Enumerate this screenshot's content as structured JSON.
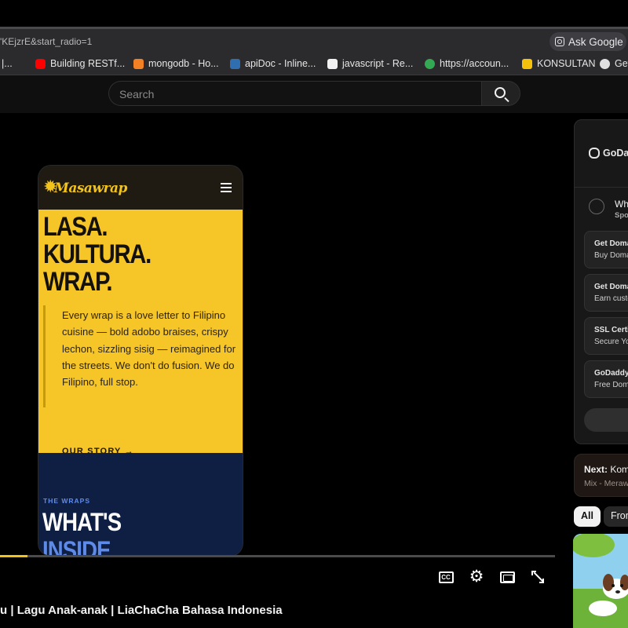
{
  "browser": {
    "url_fragment": "'KEjzrE&start_radio=1",
    "ask_google": "Ask Google",
    "bookmarks": [
      {
        "label": "|...",
        "color": "#4a4a4a"
      },
      {
        "label": "Building RESTf...",
        "color": "#ff0000"
      },
      {
        "label": "mongodb - Ho...",
        "color": "#f48024"
      },
      {
        "label": "apiDoc - Inline...",
        "color": "#2f6fb0"
      },
      {
        "label": "javascript - Re...",
        "color": "#f2f2f2"
      },
      {
        "label": "https://accoun...",
        "color": "#34a853"
      },
      {
        "label": "KONSULTAN",
        "color": "#f4c20d"
      },
      {
        "label": "Get",
        "color": "#e0e0e0"
      }
    ]
  },
  "youtube": {
    "search_placeholder": "Search",
    "player": {
      "progress": 0.05,
      "accent": "#f1c21b",
      "controls": [
        "cc-icon",
        "settings-icon",
        "theater-icon",
        "fullscreen-icon"
      ]
    },
    "video_frame": {
      "brand": "Masawrap",
      "hero_lines": [
        "LASA.",
        "KULTURA.",
        "WRAP."
      ],
      "hero_paragraph": "Every wrap is a love letter to Filipino cuisine — bold adobo braises, crispy lechon, sizzling sisig — reimagined for the streets. We don't do fusion. We do Filipino, full stop.",
      "story_link": "OUR STORY →",
      "section_tag": "THE WRAPS",
      "section_title_lines": [
        "WHAT'S",
        "INSIDE"
      ],
      "colors": {
        "yellow": "#f6c528",
        "navy": "#0f1f44"
      }
    },
    "video_title": "u | Lagu Anak-anak | LiaChaCha Bahasa Indonesia",
    "sidebar": {
      "ad": {
        "brand": "GoDad",
        "heading": "Wh",
        "sponsor": "Spo",
        "items": [
          {
            "title": "Get Doma",
            "sub": "Buy Doma"
          },
          {
            "title": "Get Doma",
            "sub": "Earn custo"
          },
          {
            "title": "SSL Certif",
            "sub": "Secure Yo"
          },
          {
            "title": "GoDaddy V",
            "sub": "Free Doma"
          }
        ]
      },
      "next": {
        "label": "Next:",
        "title": "Komp",
        "sub": "Mix - Merawa"
      },
      "chips": [
        "All",
        "From"
      ]
    }
  }
}
